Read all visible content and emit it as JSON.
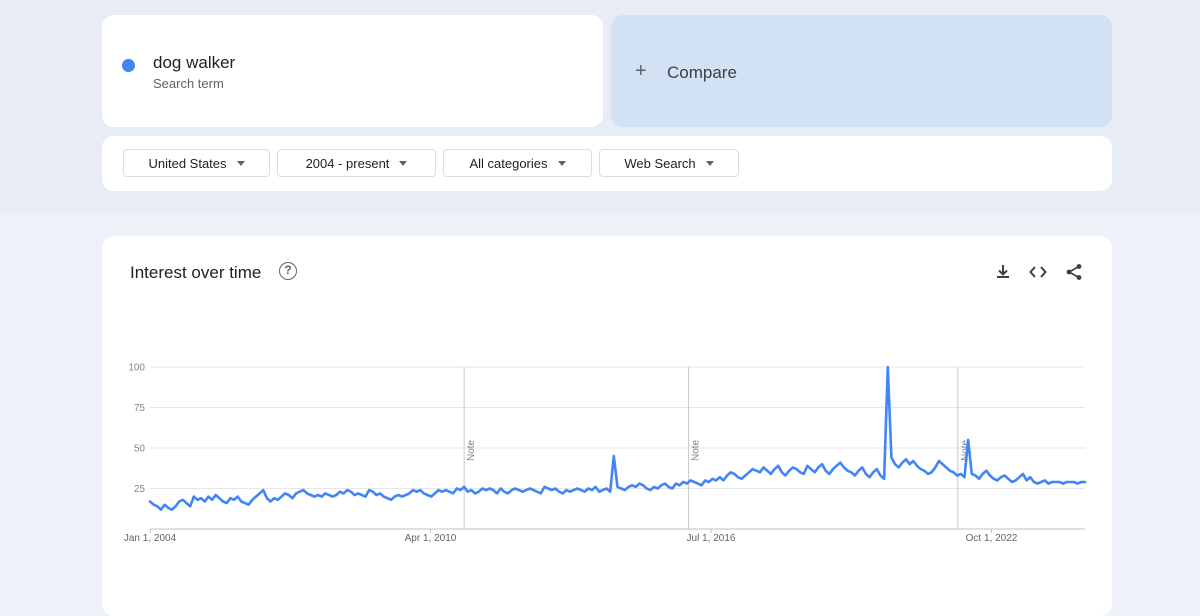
{
  "search": {
    "term": "dog walker",
    "term_subtitle": "Search term",
    "term_color": "#4285f4",
    "compare_label": "Compare"
  },
  "filters": [
    {
      "label": "United States"
    },
    {
      "label": "2004 - present"
    },
    {
      "label": "All categories"
    },
    {
      "label": "Web Search"
    }
  ],
  "panel": {
    "title": "Interest over time",
    "icons": [
      "help-icon",
      "download-icon",
      "embed-code-icon",
      "share-icon"
    ]
  },
  "chart_data": {
    "type": "line",
    "title": "",
    "xlabel": "",
    "ylabel": "",
    "ylim": [
      0,
      100
    ],
    "yticks": [
      25,
      50,
      75,
      100
    ],
    "x_start": "2004-01",
    "x_end": "2024-11",
    "xtick_labels": [
      {
        "date": "2004-01",
        "label": "Jan 1, 2004"
      },
      {
        "date": "2010-04",
        "label": "Apr 1, 2010"
      },
      {
        "date": "2016-07",
        "label": "Jul 1, 2016"
      },
      {
        "date": "2022-10",
        "label": "Oct 1, 2022"
      }
    ],
    "notes": [
      {
        "date": "2011-01",
        "label": "Note"
      },
      {
        "date": "2016-01",
        "label": "Note"
      },
      {
        "date": "2022-01",
        "label": "Note"
      }
    ],
    "grid": true,
    "legend": "none",
    "series": [
      {
        "color": "#4285f4",
        "values": [
          17,
          15,
          14,
          12,
          15,
          13,
          12,
          14,
          17,
          18,
          16,
          14,
          20,
          18,
          19,
          17,
          20,
          18,
          21,
          19,
          17,
          16,
          19,
          18,
          20,
          17,
          16,
          15,
          18,
          20,
          22,
          24,
          19,
          17,
          19,
          18,
          20,
          22,
          21,
          19,
          22,
          23,
          24,
          22,
          21,
          20,
          21,
          20,
          22,
          21,
          20,
          21,
          23,
          22,
          24,
          23,
          21,
          22,
          21,
          20,
          24,
          23,
          21,
          22,
          20,
          19,
          18,
          20,
          21,
          20,
          21,
          22,
          24,
          23,
          24,
          22,
          21,
          20,
          22,
          24,
          23,
          24,
          23,
          22,
          25,
          24,
          26,
          23,
          24,
          22,
          23,
          25,
          24,
          25,
          24,
          22,
          25,
          23,
          22,
          24,
          25,
          24,
          23,
          24,
          25,
          24,
          23,
          22,
          26,
          25,
          24,
          25,
          23,
          22,
          24,
          23,
          24,
          25,
          24,
          23,
          25,
          24,
          26,
          23,
          24,
          25,
          23,
          45,
          26,
          25,
          24,
          26,
          27,
          26,
          28,
          27,
          25,
          24,
          26,
          25,
          27,
          28,
          26,
          25,
          28,
          27,
          29,
          28,
          30,
          29,
          28,
          27,
          30,
          29,
          31,
          30,
          32,
          30,
          33,
          35,
          34,
          32,
          31,
          33,
          35,
          37,
          36,
          35,
          38,
          36,
          34,
          37,
          39,
          35,
          33,
          36,
          38,
          37,
          35,
          34,
          39,
          37,
          35,
          38,
          40,
          36,
          34,
          37,
          39,
          41,
          38,
          36,
          35,
          33,
          36,
          38,
          34,
          32,
          35,
          37,
          33,
          31,
          100,
          44,
          40,
          38,
          41,
          43,
          40,
          42,
          39,
          37,
          36,
          34,
          35,
          38,
          42,
          40,
          38,
          36,
          35,
          33,
          34,
          32,
          55,
          34,
          33,
          31,
          34,
          36,
          33,
          31,
          30,
          32,
          33,
          31,
          29,
          30,
          32,
          34,
          30,
          32,
          29,
          28,
          29,
          30,
          28,
          29,
          29,
          29,
          28,
          29,
          29,
          29,
          28,
          29,
          29
        ]
      }
    ]
  }
}
